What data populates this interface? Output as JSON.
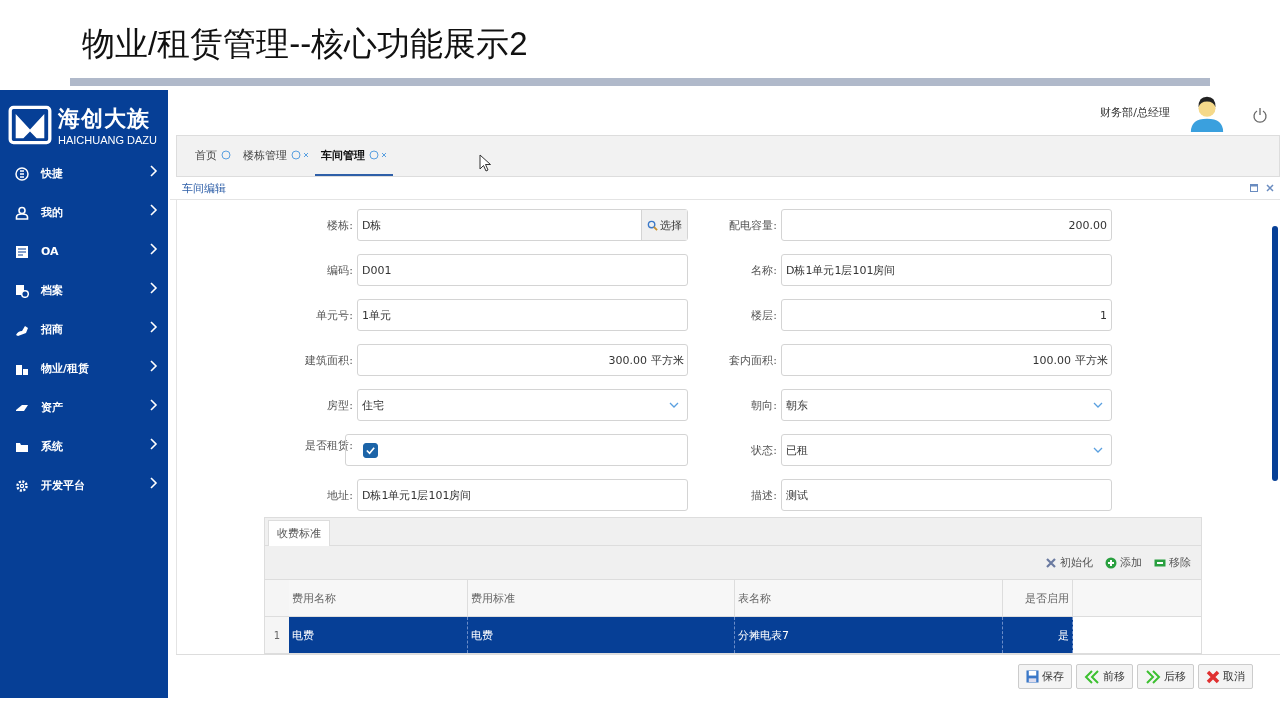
{
  "slide_title": "物业/租赁管理--核心功能展示2",
  "logo": {
    "name": "海创大族",
    "subtitle": "HAICHUANG DAZU"
  },
  "sidebar": {
    "items": [
      {
        "label": "快捷"
      },
      {
        "label": "我的"
      },
      {
        "label": "OA"
      },
      {
        "label": "档案"
      },
      {
        "label": "招商"
      },
      {
        "label": "物业/租赁"
      },
      {
        "label": "资产"
      },
      {
        "label": "系统"
      },
      {
        "label": "开发平台"
      }
    ]
  },
  "header": {
    "user": "财务部/总经理"
  },
  "tabs": [
    {
      "label": "首页",
      "closable": false,
      "selected": false
    },
    {
      "label": "楼栋管理",
      "closable": true,
      "selected": false
    },
    {
      "label": "车间管理",
      "closable": true,
      "selected": true
    }
  ],
  "panel": {
    "title": "车间编辑"
  },
  "fields": [
    {
      "label": "楼栋:",
      "kind": "lookup",
      "value": "D栋",
      "button": "选择"
    },
    {
      "label": "配电容量:",
      "kind": "number",
      "value": "200.00"
    },
    {
      "label": "编码:",
      "kind": "text",
      "value": "D001"
    },
    {
      "label": "名称:",
      "kind": "text",
      "value": "D栋1单元1层101房间"
    },
    {
      "label": "单元号:",
      "kind": "text",
      "value": "1单元"
    },
    {
      "label": "楼层:",
      "kind": "number",
      "value": "1"
    },
    {
      "label": "建筑面积:",
      "kind": "number",
      "value": "300.00",
      "unit": "平方米"
    },
    {
      "label": "套内面积:",
      "kind": "number",
      "value": "100.00",
      "unit": "平方米"
    },
    {
      "label": "房型:",
      "kind": "select",
      "value": "住宅"
    },
    {
      "label": "朝向:",
      "kind": "select",
      "value": "朝东"
    },
    {
      "label": "是否租赁:",
      "kind": "checkbox",
      "checked": true
    },
    {
      "label": "状态:",
      "kind": "select",
      "value": "已租"
    },
    {
      "label": "地址:",
      "kind": "text",
      "value": "D栋1单元1层101房间"
    },
    {
      "label": "描述:",
      "kind": "text",
      "value": "测试"
    }
  ],
  "sub_tabs": [
    {
      "label": "收费标准",
      "selected": true
    }
  ],
  "grid": {
    "toolbar": [
      {
        "label": "初始化"
      },
      {
        "label": "添加"
      },
      {
        "label": "移除"
      }
    ],
    "columns": [
      "费用名称",
      "费用标准",
      "表名称",
      "是否启用"
    ],
    "rows": [
      {
        "number": "1",
        "cells": [
          "电费",
          "电费",
          "分摊电表7",
          "是"
        ],
        "selected": true
      }
    ]
  },
  "buttons": [
    {
      "label": "保存"
    },
    {
      "label": "前移"
    },
    {
      "label": "后移"
    },
    {
      "label": "取消"
    }
  ]
}
